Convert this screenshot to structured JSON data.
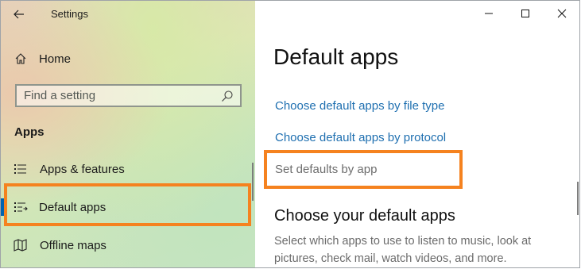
{
  "window": {
    "title": "Settings",
    "controls": [
      "minimize",
      "maximize",
      "close"
    ]
  },
  "sidebar": {
    "home_label": "Home",
    "search": {
      "placeholder": "Find a setting"
    },
    "section_label": "Apps",
    "items": [
      {
        "label": "Apps & features",
        "icon": "list-icon",
        "selected": false
      },
      {
        "label": "Default apps",
        "icon": "list-check-icon",
        "selected": true
      },
      {
        "label": "Offline maps",
        "icon": "map-icon",
        "selected": false
      }
    ]
  },
  "main": {
    "title": "Default apps",
    "links": [
      {
        "label": "Choose default apps by file type"
      },
      {
        "label": "Choose default apps by protocol"
      },
      {
        "label": "Set defaults by app"
      }
    ],
    "subheading": "Choose your default apps",
    "description": "Select which apps to use to listen to music, look at pictures, check mail, watch videos, and more."
  },
  "colors": {
    "accent": "#0063b1",
    "link": "#1e6fb0",
    "highlight": "#f5821f"
  }
}
